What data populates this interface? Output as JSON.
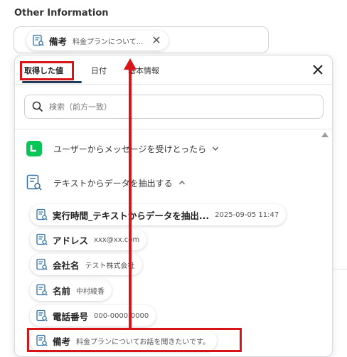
{
  "section_title": "Other Information",
  "selected_field": {
    "name": "備考",
    "value": "料金プランについて..."
  },
  "tabs": [
    {
      "label": "取得した値"
    },
    {
      "label": "日付"
    },
    {
      "label": "基本情報"
    }
  ],
  "search": {
    "placeholder": "検索（前方一致）"
  },
  "groups": [
    {
      "label": "ユーザーからメッセージを受けとったら"
    },
    {
      "label": "テキストからデータを抽出する"
    }
  ],
  "items": [
    {
      "name": "実行時間_テキストからデータを抽出...",
      "value": "2025-09-05 11:47"
    },
    {
      "name": "アドレス",
      "value": "xxx@xx.com"
    },
    {
      "name": "会社名",
      "value": "テスト株式会社"
    },
    {
      "name": "名前",
      "value": "中村綾香"
    },
    {
      "name": "電話番号",
      "value": "000-0000-0000"
    },
    {
      "name": "備考",
      "value": "料金プランについてお話を聞きたいです。"
    }
  ],
  "colors": {
    "accent": "#1f3b57",
    "highlight": "#d91418",
    "line_green": "#06c755",
    "icon_blue": "#2f6fa3"
  }
}
